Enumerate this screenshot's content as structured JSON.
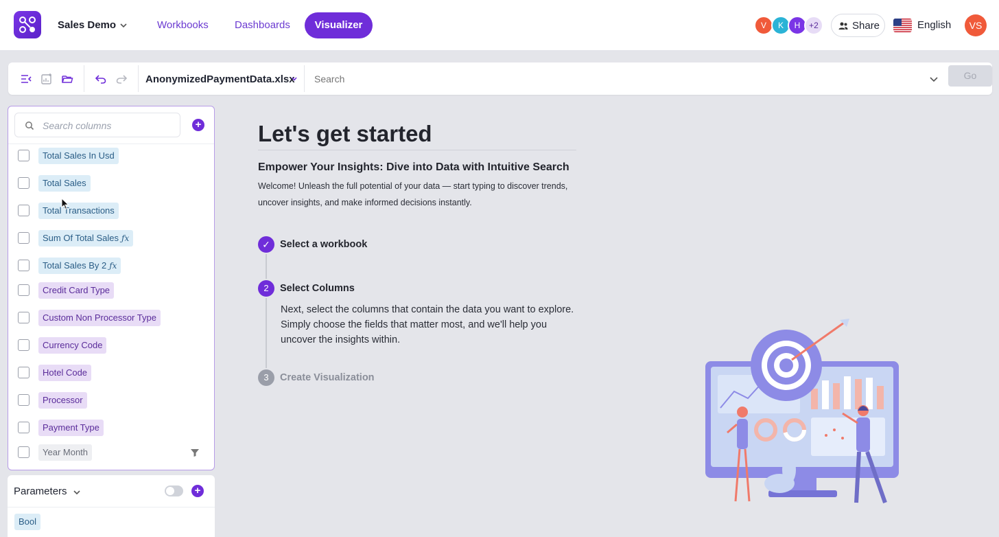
{
  "topbar": {
    "app_name": "Sales Demo",
    "nav": [
      "Workbooks",
      "Dashboards"
    ],
    "nav_active": "Visualizer",
    "avatars": [
      {
        "initial": "V",
        "color": "#f05a3a"
      },
      {
        "initial": "K",
        "color": "#2bb3d6"
      },
      {
        "initial": "H",
        "color": "#7a35e6"
      }
    ],
    "avatar_more": "+2",
    "share_label": "Share",
    "language": "English",
    "user_initials": "VS"
  },
  "toolbar": {
    "file_name": "AnonymizedPaymentData.xlsx",
    "search_placeholder": "Search",
    "go_label": "Go"
  },
  "columns_panel": {
    "search_placeholder": "Search columns",
    "columns": [
      {
        "label": "Total Sales In Usd",
        "kind": "blue",
        "formula": false
      },
      {
        "label": "Total Sales",
        "kind": "blue",
        "formula": false
      },
      {
        "label": "Total Transactions",
        "kind": "blue",
        "formula": false
      },
      {
        "label": "Sum Of Total Sales",
        "kind": "blue",
        "formula": true
      },
      {
        "label": "Total Sales By 2",
        "kind": "blue",
        "formula": true
      },
      {
        "label": "Credit Card Type",
        "kind": "purple",
        "formula": false
      },
      {
        "label": "Custom Non Processor Type",
        "kind": "purple",
        "formula": false
      },
      {
        "label": "Currency Code",
        "kind": "purple",
        "formula": false
      },
      {
        "label": "Hotel Code",
        "kind": "purple",
        "formula": false
      },
      {
        "label": "Processor",
        "kind": "purple",
        "formula": false
      },
      {
        "label": "Payment Type",
        "kind": "purple",
        "formula": false
      },
      {
        "label": "Year Month",
        "kind": "gray",
        "formula": false
      }
    ],
    "formula_glyph": "ƒx"
  },
  "parameters": {
    "title": "Parameters",
    "items": [
      "Bool"
    ]
  },
  "main": {
    "heading": "Let's get started",
    "subtitle": "Empower Your Insights: Dive into Data with Intuitive Search",
    "welcome_line1": "Welcome! Unleash the full potential of your data — start typing to discover trends,",
    "welcome_line2": "uncover insights, and make informed decisions instantly.",
    "steps": [
      {
        "number": "✓",
        "label": "Select a workbook",
        "state": "done"
      },
      {
        "number": "2",
        "label": "Select Columns",
        "state": "active"
      },
      {
        "number": "3",
        "label": "Create Visualization",
        "state": "pending"
      }
    ],
    "step2_desc": "Next, select the columns that contain the data you want to explore. Simply choose the fields that matter most, and we'll help you uncover the insights within."
  },
  "colors": {
    "accent": "#6f2dd9",
    "step_pending": "#9a9ea9"
  }
}
